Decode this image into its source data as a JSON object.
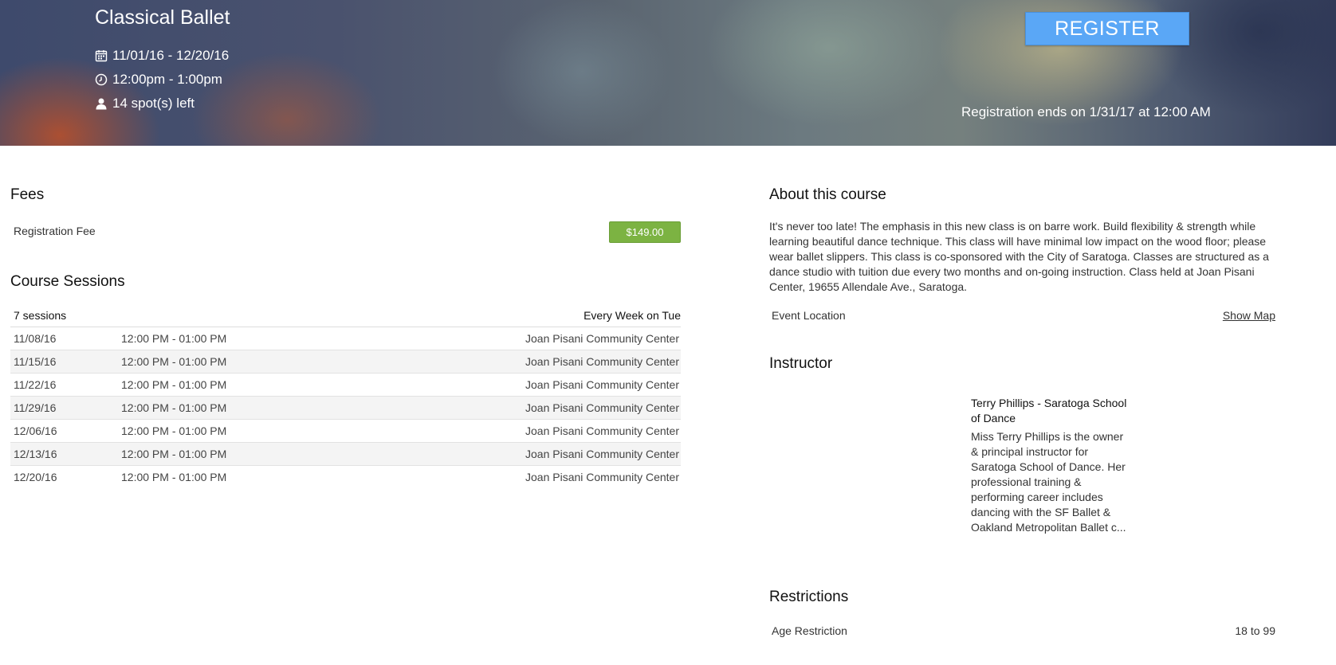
{
  "header": {
    "title": "Classical Ballet",
    "dates": "11/01/16 - 12/20/16",
    "time": "12:00pm - 1:00pm",
    "spots": "14 spot(s) left",
    "register_label": "REGISTER",
    "registration_ends": "Registration ends on 1/31/17 at 12:00 AM",
    "icons": [
      "calendar-icon",
      "clock-icon",
      "person-icon"
    ]
  },
  "fees": {
    "title": "Fees",
    "items": [
      {
        "label": "Registration Fee",
        "amount": "$149.00"
      }
    ],
    "badge_color": "#7cb342"
  },
  "sessions": {
    "title": "Course Sessions",
    "count_label": "7 sessions",
    "schedule_label": "Every Week on Tue",
    "rows": [
      {
        "date": "11/08/16",
        "time": "12:00 PM - 01:00 PM",
        "location": "Joan Pisani Community Center"
      },
      {
        "date": "11/15/16",
        "time": "12:00 PM - 01:00 PM",
        "location": "Joan Pisani Community Center"
      },
      {
        "date": "11/22/16",
        "time": "12:00 PM - 01:00 PM",
        "location": "Joan Pisani Community Center"
      },
      {
        "date": "11/29/16",
        "time": "12:00 PM - 01:00 PM",
        "location": "Joan Pisani Community Center"
      },
      {
        "date": "12/06/16",
        "time": "12:00 PM - 01:00 PM",
        "location": "Joan Pisani Community Center"
      },
      {
        "date": "12/13/16",
        "time": "12:00 PM - 01:00 PM",
        "location": "Joan Pisani Community Center"
      },
      {
        "date": "12/20/16",
        "time": "12:00 PM - 01:00 PM",
        "location": "Joan Pisani Community Center"
      }
    ]
  },
  "about": {
    "title": "About this course",
    "text": "It's never too late! The emphasis in this new class is on barre work.  Build flexibility & strength while learning beautiful dance technique. This class will have minimal low impact on the wood floor; please wear ballet slippers. This class is co-sponsored with the City of Saratoga. Classes are structured as a dance studio with tuition due every two months and on-going instruction. Class held at Joan Pisani Center, 19655 Allendale Ave., Saratoga.",
    "location_label": "Event Location",
    "show_map_label": "Show Map"
  },
  "instructor": {
    "title": "Instructor",
    "name": "Terry Phillips - Saratoga School of Dance",
    "bio": "Miss Terry Phillips is the owner & principal instructor for Saratoga School of Dance. Her professional training & performing career includes dancing with the SF Ballet & Oakland Metropolitan Ballet c..."
  },
  "restrictions": {
    "title": "Restrictions",
    "label": "Age Restriction",
    "value": "18 to 99"
  },
  "colors": {
    "register_button": "#5aa7f6",
    "fee_badge": "#7cb342"
  }
}
